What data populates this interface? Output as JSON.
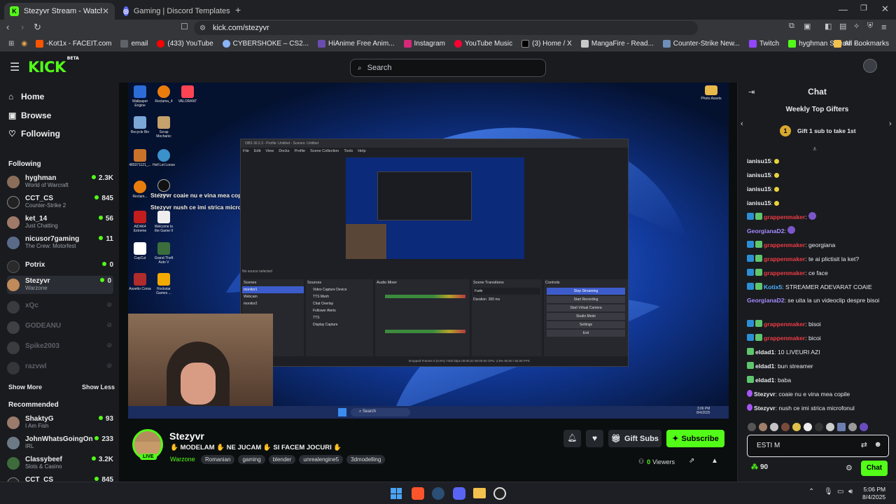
{
  "browser": {
    "tabs": [
      {
        "title": "Stezyvr Stream - Watch Live o",
        "active": true
      },
      {
        "title": "Gaming | Discord Templates",
        "active": false
      }
    ],
    "url": "kick.com/stezyvr",
    "bookmarks": [
      "-Kot1x - FACEIT.com",
      "email",
      "(433) YouTube",
      "CYBERSHOKE – CS2...",
      "HiAnime Free Anim...",
      "Instagram",
      "YouTube Music",
      "(3) Home / X",
      "MangaFire - Read...",
      "Counter-Strike New...",
      "Twitch",
      "hyghman Stream -..."
    ],
    "all_bookmarks": "All Bookmarks"
  },
  "kick": {
    "logo": "KICK",
    "logo_tag": "BETA",
    "search_placeholder": "Search"
  },
  "sidebar": {
    "nav": [
      {
        "icon": "home-icon",
        "label": "Home"
      },
      {
        "icon": "browse-icon",
        "label": "Browse"
      },
      {
        "icon": "heart-icon",
        "label": "Following"
      }
    ],
    "following_heading": "Following",
    "following": [
      {
        "name": "hyghman",
        "game": "World of Warcraft",
        "viewers": "2.3K",
        "live": true
      },
      {
        "name": "CCT_CS",
        "game": "Counter-Strike 2",
        "viewers": "845",
        "live": true
      },
      {
        "name": "ket_14",
        "game": "Just Chatting",
        "viewers": "56",
        "live": true
      },
      {
        "name": "nicusor7gaming",
        "game": "The Crew: Motorfest",
        "viewers": "11",
        "live": true
      },
      {
        "name": "Potrix",
        "game": "",
        "viewers": "0",
        "live": true
      },
      {
        "name": "Stezyvr",
        "game": "Warzone",
        "viewers": "0",
        "live": true
      },
      {
        "name": "xQc",
        "game": "",
        "viewers": "",
        "live": false
      },
      {
        "name": "GODEANU",
        "game": "",
        "viewers": "",
        "live": false
      },
      {
        "name": "Spike2003",
        "game": "",
        "viewers": "",
        "live": false
      },
      {
        "name": "razvwl",
        "game": "",
        "viewers": "",
        "live": false
      }
    ],
    "show_more": "Show More",
    "show_less": "Show Less",
    "recommended_heading": "Recommended",
    "recommended": [
      {
        "name": "ShaktyG",
        "game": "I Am Fish",
        "viewers": "93"
      },
      {
        "name": "JohnWhatsGoingOn",
        "game": "IRL",
        "viewers": "233"
      },
      {
        "name": "Classybeef",
        "game": "Slots & Casino",
        "viewers": "3.2K"
      },
      {
        "name": "CCT_CS",
        "game": "",
        "viewers": "845"
      }
    ]
  },
  "video": {
    "overlay_lines": [
      "Stezyvr coaie nu e vina mea copile",
      "Stezyvr nush ce imi strica microfonul"
    ],
    "desktop_icons": [
      "Wallpaper Engine",
      "Reclama_4",
      "VALORANT",
      "Recycle Bin",
      "Scrap Mechanic",
      "480371121_...",
      "Hell Let Loose",
      "Reclam...",
      "Engine",
      "AIDA64 Extreme",
      "Welcome to the Game II",
      "CapCut",
      "Grand Theft Auto V",
      "Assetto Corsa",
      "Rockstar Games ..."
    ],
    "photo_assets": "Photo Assets",
    "obs_title": "OBS 30.2.3 - Profile: Untitled - Scenes: Untitled",
    "obs_menu": [
      "File",
      "Edit",
      "View",
      "Docks",
      "Profile",
      "Scene Collection",
      "Tools",
      "Help"
    ],
    "obs_no_source": "No source selected",
    "obs_panels": [
      "Scenes",
      "Sources",
      "Audio Mixer",
      "Scene Transitions",
      "Controls"
    ],
    "obs_scenes": [
      "monitor1",
      "Webcam",
      "monitor2"
    ],
    "obs_sources": [
      "Video Capture Device",
      "TTS Msnh",
      "Chat Overlay",
      "Follower Alerts",
      "TTS",
      "Display Capture"
    ],
    "obs_controls": [
      "Stop Streaming",
      "Start Recording",
      "Start Virtual Camera",
      "Studio Mode",
      "Settings",
      "Exit"
    ],
    "obs_transition": "Fade",
    "obs_duration_label": "Duration",
    "obs_duration": "300 ms",
    "obs_status": "Dropped Frames 0 (0.0%)   7402 kbps   00:00:22   00:00:00   CPU: 2.5%   60.00 / 60.00 FPS",
    "taskbar_time": "3:06 PM",
    "taskbar_date": "8/4/2025"
  },
  "stream": {
    "streamer": "Stezyvr",
    "live_label": "LIVE",
    "title": "✋ MODELAM ✋ NE JUCAM ✋ SI FACEM JOCURI ✋",
    "category": "Warzone",
    "tags": [
      "Romanian",
      "gaming",
      "blender",
      "unrealengine5",
      "3dmodelling"
    ],
    "viewers_count": "0",
    "viewers_label": "Viewers",
    "gift_subs": "Gift Subs",
    "subscribe": "Subscribe"
  },
  "chat": {
    "title": "Chat",
    "top_gifters": "Weekly Top Gifters",
    "gift_rank": "1",
    "gift_cta": "Gift 1 sub to take 1st",
    "messages": [
      {
        "user": "ianisu15",
        "text": "",
        "color": "white",
        "badges": 0,
        "emote": true
      },
      {
        "user": "ianisu15",
        "text": "",
        "color": "white",
        "badges": 0,
        "emote": true
      },
      {
        "user": "ianisu15",
        "text": "",
        "color": "white",
        "badges": 0,
        "emote": true
      },
      {
        "user": "ianisu15",
        "text": "",
        "color": "white",
        "badges": 0,
        "emote": true
      },
      {
        "user": "grappenmaker",
        "text": "",
        "color": "red",
        "badges": 2,
        "emote": true
      },
      {
        "user": "GeorgianaD2",
        "text": "",
        "color": "purple",
        "badges": 0,
        "emote": true
      },
      {
        "user": "grappenmaker",
        "text": "georgiana",
        "color": "red",
        "badges": 2,
        "emote": false
      },
      {
        "user": "grappenmaker",
        "text": "te ai plictisit la ket?",
        "color": "red",
        "badges": 2,
        "emote": false
      },
      {
        "user": "grappenmaker",
        "text": "ce face",
        "color": "red",
        "badges": 2,
        "emote": false
      },
      {
        "user": "Kotix5",
        "text": "STREAMER ADEVARAT COAIE",
        "color": "blue",
        "badges": 2,
        "emote": false
      },
      {
        "user": "GeorgianaD2",
        "text": "se uita la un videoclip despre bisoi",
        "color": "purple",
        "badges": 0,
        "emote": false
      },
      {
        "user": "grappenmaker",
        "text": "bisoi",
        "color": "red",
        "badges": 2,
        "emote": false
      },
      {
        "user": "grappenmaker",
        "text": "bicoi",
        "color": "red",
        "badges": 2,
        "emote": false
      },
      {
        "user": "eldad1",
        "text": "10 LIVEURI AZI",
        "color": "white",
        "badges": 1,
        "emote": false
      },
      {
        "user": "eldad1",
        "text": "bun streamer",
        "color": "white",
        "badges": 1,
        "emote": false
      },
      {
        "user": "eldad1",
        "text": "baba",
        "color": "white",
        "badges": 1,
        "emote": false
      },
      {
        "user": "Stezyvr",
        "text": "coaie nu e vina mea copile",
        "color": "white",
        "badges": 1,
        "emote": false
      },
      {
        "user": "Stezyvr",
        "text": "nush ce imi strica microfonul",
        "color": "white",
        "badges": 1,
        "emote": false
      }
    ],
    "input_value": "ESTI M",
    "points": "90",
    "send": "Chat"
  },
  "taskbar": {
    "time": "5:06 PM",
    "date": "8/4/2025"
  },
  "colors": {
    "kick_green": "#53fc18",
    "chat_red": "#ee3b45",
    "chat_purple": "#a68bff",
    "chat_blue": "#4bb1ff",
    "page_bg": "#0b0e0f",
    "panel_bg": "#191b1f"
  }
}
